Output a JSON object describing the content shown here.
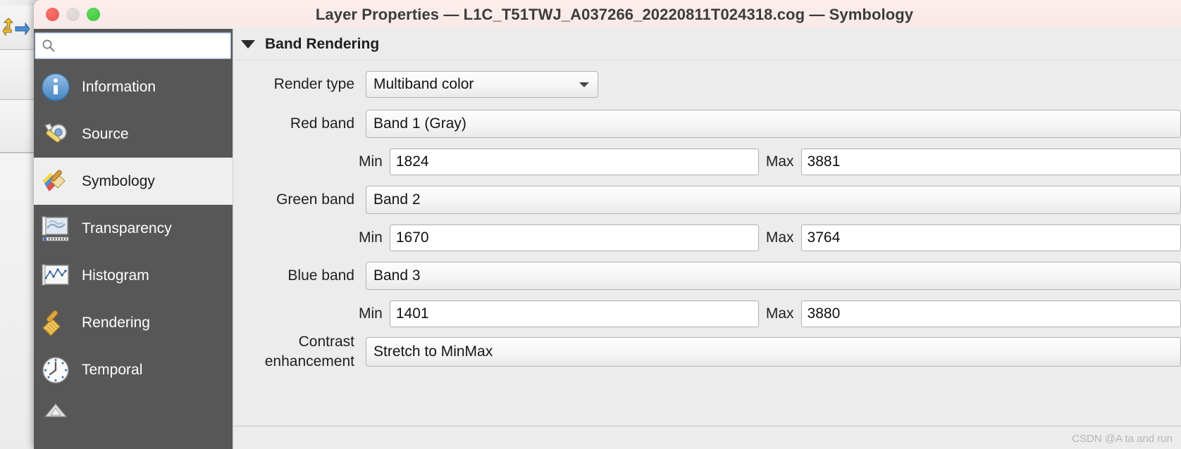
{
  "window": {
    "title": "Layer Properties — L1C_T51TWJ_A037266_20220811T024318.cog — Symbology",
    "controls": {
      "close": "close-button",
      "minimize": "minimize-button",
      "maximize": "maximize-button"
    }
  },
  "search": {
    "value": "",
    "placeholder": ""
  },
  "sidebar": {
    "items": [
      {
        "label": "Information",
        "icon": "information-icon",
        "active": false
      },
      {
        "label": "Source",
        "icon": "source-icon",
        "active": false
      },
      {
        "label": "Symbology",
        "icon": "symbology-icon",
        "active": true
      },
      {
        "label": "Transparency",
        "icon": "transparency-icon",
        "active": false
      },
      {
        "label": "Histogram",
        "icon": "histogram-icon",
        "active": false
      },
      {
        "label": "Rendering",
        "icon": "rendering-icon",
        "active": false
      },
      {
        "label": "Temporal",
        "icon": "temporal-icon",
        "active": false
      },
      {
        "label": "",
        "icon": "pyramids-icon",
        "active": false
      }
    ]
  },
  "main": {
    "section_title": "Band Rendering",
    "render_type": {
      "label": "Render type",
      "value": "Multiband color"
    },
    "bands": [
      {
        "label": "Red band",
        "band_value": "Band 1 (Gray)",
        "min_label": "Min",
        "min_value": "1824",
        "max_label": "Max",
        "max_value": "3881"
      },
      {
        "label": "Green band",
        "band_value": "Band 2",
        "min_label": "Min",
        "min_value": "1670",
        "max_label": "Max",
        "max_value": "3764"
      },
      {
        "label": "Blue band",
        "band_value": "Band 3",
        "min_label": "Min",
        "min_value": "1401",
        "max_label": "Max",
        "max_value": "3880"
      }
    ],
    "contrast": {
      "label": "Contrast enhancement",
      "value": "Stretch to MinMax"
    }
  },
  "status": {
    "watermark": "CSDN @A ta and run"
  },
  "colors": {
    "titlebar": "#f9ece9",
    "sidebar": "#575757",
    "sidebar_active_bg": "#efefef",
    "panel_bg": "#ececec",
    "accent_red": "#e8564e",
    "accent_green": "#3cc63a"
  }
}
